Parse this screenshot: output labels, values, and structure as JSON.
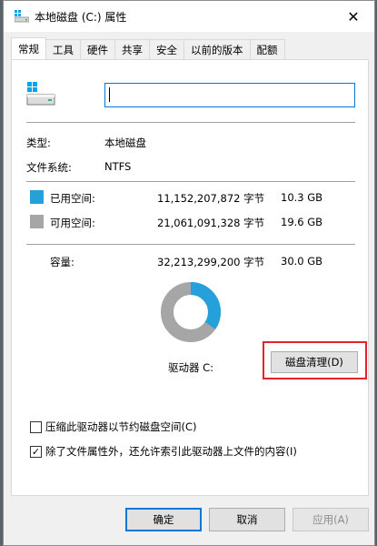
{
  "window": {
    "title": "本地磁盘 (C:) 属性",
    "close_glyph": "✕",
    "icon": "drive-icon"
  },
  "tabs": [
    {
      "label": "常规",
      "active": true
    },
    {
      "label": "工具",
      "active": false
    },
    {
      "label": "硬件",
      "active": false
    },
    {
      "label": "共享",
      "active": false
    },
    {
      "label": "安全",
      "active": false
    },
    {
      "label": "以前的版本",
      "active": false
    },
    {
      "label": "配额",
      "active": false
    }
  ],
  "general": {
    "name_value": "",
    "type_label": "类型:",
    "type_value": "本地磁盘",
    "fs_label": "文件系统:",
    "fs_value": "NTFS",
    "used": {
      "label": "已用空间:",
      "bytes": "11,152,207,872 字节",
      "size": "10.3 GB",
      "color": "#26a0da"
    },
    "free": {
      "label": "可用空间:",
      "bytes": "21,061,091,328 字节",
      "size": "19.6 GB",
      "color": "#a6a6a6"
    },
    "capacity": {
      "label": "容量:",
      "bytes": "32,213,299,200 字节",
      "size": "30.0 GB"
    },
    "drive_label": "驱动器 C:",
    "used_fraction": 0.346,
    "cleanup_button": "磁盘清理(D)"
  },
  "options": {
    "compress": {
      "label": "压缩此驱动器以节约磁盘空间(C)",
      "checked": false
    },
    "index": {
      "label": "除了文件属性外，还允许索引此驱动器上文件的内容(I)",
      "checked": true
    }
  },
  "footer": {
    "ok": "确定",
    "cancel": "取消",
    "apply": "应用(A)"
  }
}
